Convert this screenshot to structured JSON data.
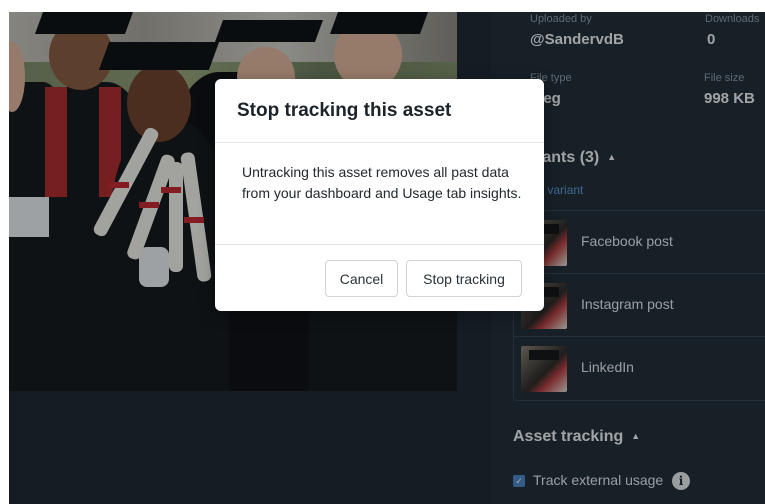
{
  "panel": {
    "uploaded_by_label": "Uploaded by",
    "uploaded_by_value": "@SandervdB",
    "downloads_label": "Downloads",
    "downloads_value": "0",
    "file_type_label": "File type",
    "file_type_value": "jpeg",
    "file_size_label": "File size",
    "file_size_value": "998 KB",
    "variants_title": "Variants (3)",
    "add_variant": "+ Add variant",
    "variants": [
      {
        "name": "Facebook post"
      },
      {
        "name": "Instagram post"
      },
      {
        "name": "LinkedIn"
      }
    ],
    "asset_tracking_title": "Asset tracking",
    "track_external_label": "Track external usage",
    "track_external_checked": true
  },
  "modal": {
    "title": "Stop tracking this asset",
    "body": "Untracking this asset removes all past data from your dashboard and Usage tab insights.",
    "cancel_label": "Cancel",
    "confirm_label": "Stop tracking"
  },
  "icons": {
    "caret": "caret-up-icon",
    "info": "info-icon",
    "check": "checkmark-icon"
  },
  "colors": {
    "panel_bg": "#202a34",
    "accent": "#4b86c8",
    "link": "#5a9bd8"
  }
}
